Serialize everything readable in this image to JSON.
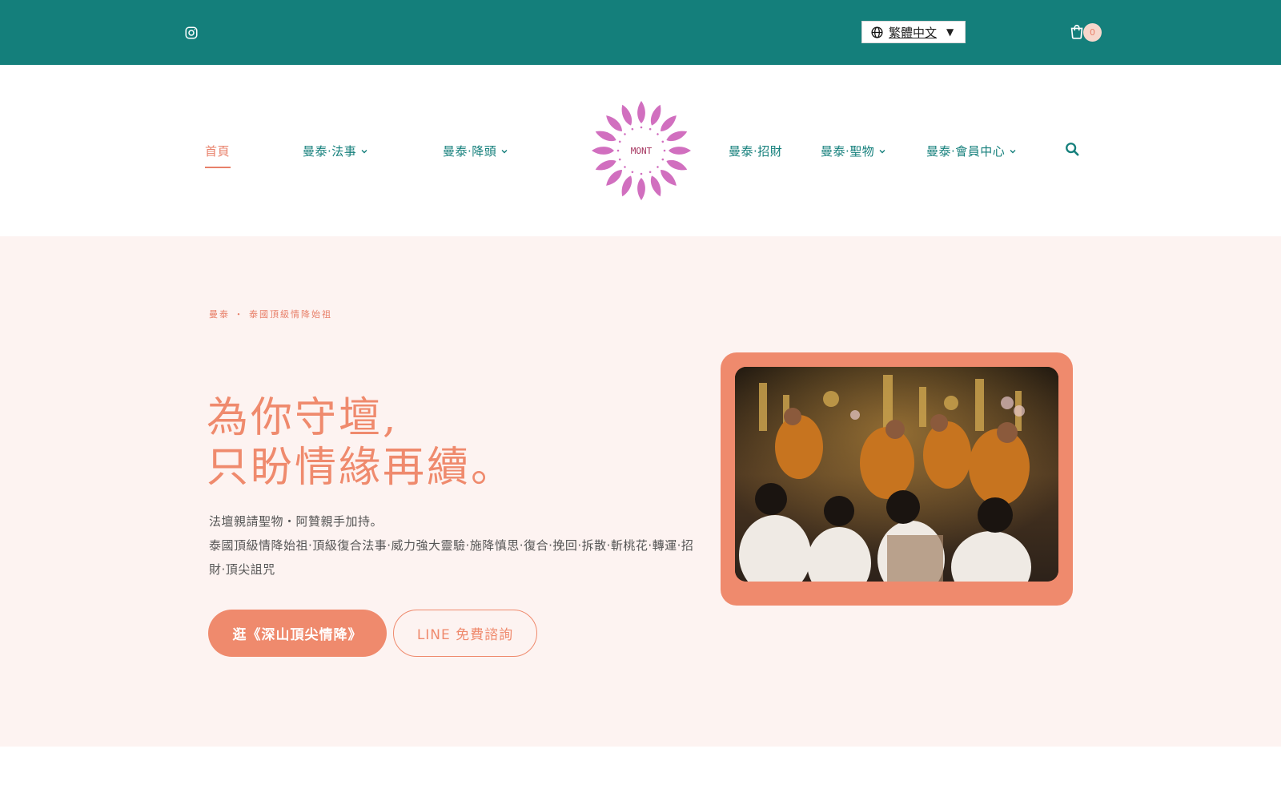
{
  "topbar": {
    "language": "繁體中文",
    "cart_count": "0",
    "colors": {
      "bar": "#147f7b"
    }
  },
  "nav": {
    "items": [
      {
        "label": "首頁",
        "active": true
      },
      {
        "label": "曼泰‧法事",
        "dropdown": true
      },
      {
        "label": "曼泰‧降頭",
        "dropdown": true
      },
      {
        "label": "曼泰‧招財",
        "dropdown": false
      },
      {
        "label": "曼泰‧聖物",
        "dropdown": true
      },
      {
        "label": "曼泰‧會員中心",
        "dropdown": true
      }
    ],
    "logo_text": "MONT",
    "colors": {
      "link": "#147f7b",
      "active": "#e8806a",
      "logo": "#d16fbf"
    }
  },
  "hero": {
    "eyebrow": "曼泰 ・ 泰國頂級情降始祖",
    "headline_line1": "為你守壇,",
    "headline_line2": "只盼情緣再續。",
    "sub_line1": "法壇親請聖物・阿贊親手加持。",
    "sub_line2": "泰國頂級情降始祖‧頂級復合法事‧威力強大靈驗‧施降慎思‧復合‧挽回‧拆散‧斬桃花‧轉運‧招財‧頂尖詛咒",
    "primary_button": "逛《深山頂尖情降》",
    "secondary_button": "LINE 免費諮詢",
    "colors": {
      "accent": "#ef8a6d",
      "background": "#fdf3f1"
    }
  },
  "icons": {
    "instagram": "instagram-icon",
    "globe": "globe-icon",
    "cart": "cart-icon",
    "search": "search-icon",
    "chevron": "chevron-down-icon"
  }
}
